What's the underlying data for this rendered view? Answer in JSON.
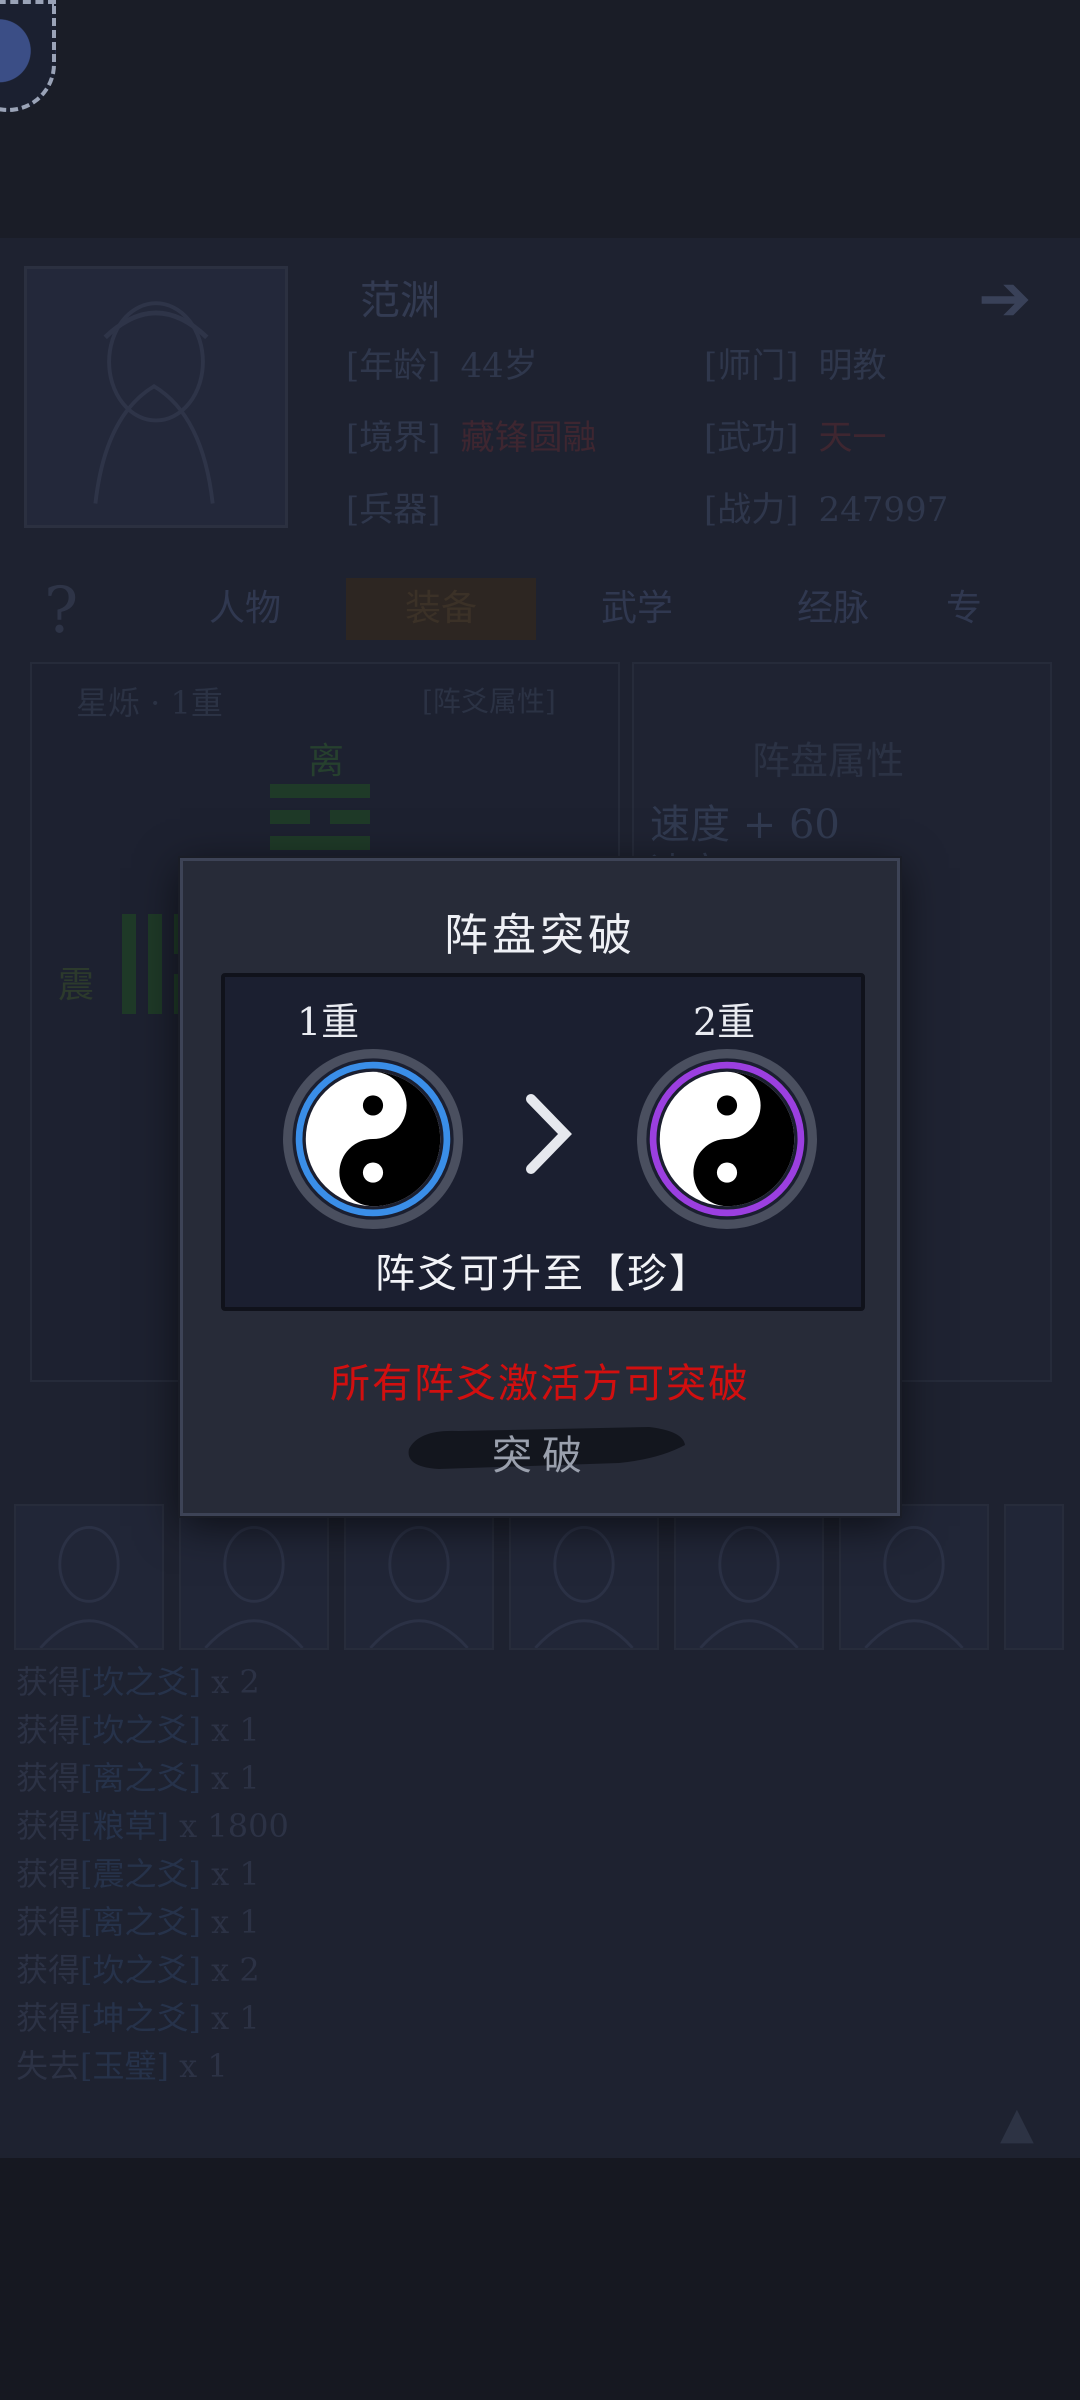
{
  "character": {
    "name": "范渊",
    "rows": [
      {
        "label": "[年龄]",
        "value": "44岁",
        "label2": "[师门]",
        "value2": "明教"
      },
      {
        "label": "[境界]",
        "value": "藏锋圆融",
        "label2": "[武功]",
        "value2": "天一"
      },
      {
        "label": "[兵器]",
        "value": "",
        "label2": "[战力]",
        "value2": "247997"
      }
    ]
  },
  "tabs": [
    "人物",
    "装备",
    "武学",
    "经脉",
    "专"
  ],
  "left_panel": {
    "title": "星烁 · 1重",
    "subtitle": "[阵爻属性]",
    "top_glyph": "离",
    "left_glyph": "震"
  },
  "right_panel": {
    "title": "阵盘属性",
    "stats": [
      "速度 + 60",
      "速度"
    ]
  },
  "log": [
    {
      "prefix": "获得",
      "item": "[坎之爻]",
      "count": "x 2"
    },
    {
      "prefix": "获得",
      "item": "[坎之爻]",
      "count": "x 1"
    },
    {
      "prefix": "获得",
      "item": "[离之爻]",
      "count": "x 1"
    },
    {
      "prefix": "获得",
      "item": "[粮草]",
      "count": "x 1800"
    },
    {
      "prefix": "获得",
      "item": "[震之爻]",
      "count": "x 1"
    },
    {
      "prefix": "获得",
      "item": "[离之爻]",
      "count": "x 1"
    },
    {
      "prefix": "获得",
      "item": "[坎之爻]",
      "count": "x 2"
    },
    {
      "prefix": "获得",
      "item": "[坤之爻]",
      "count": "x 1"
    },
    {
      "prefix": "失去",
      "item": "[玉璧]",
      "count": "x 1"
    }
  ],
  "dialog": {
    "title": "阵盘突破",
    "from_level": "1重",
    "to_level": "2重",
    "upgrade_text": "阵爻可升至【珍】",
    "warning": "所有阵爻激活方可突破",
    "button": "突破",
    "colors": {
      "from_ring": "#3a8ee8",
      "to_ring": "#9b3fe0",
      "warning": "#d20f0f"
    }
  },
  "icons": [
    "avatar-badge",
    "arrow-right-icon",
    "question-icon",
    "yin-yang-icon",
    "chevron-right-icon",
    "scroll-up-icon"
  ]
}
